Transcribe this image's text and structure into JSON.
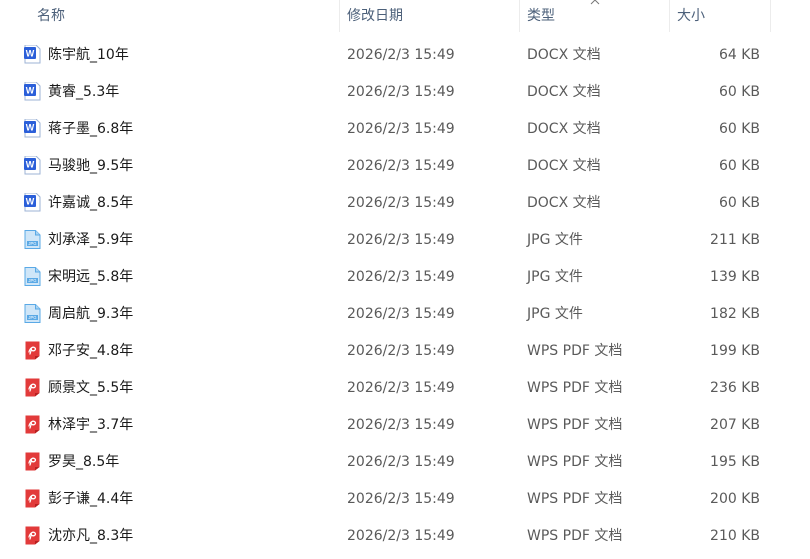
{
  "columns": {
    "name": "名称",
    "date": "修改日期",
    "type": "类型",
    "size": "大小"
  },
  "sort": {
    "column": "type",
    "direction": "ascending",
    "icon": "chevron-up-icon"
  },
  "colors": {
    "word": "#2b5fd9",
    "jpg": "#5aa9e6",
    "pdf": "#e23a3a"
  },
  "files": [
    {
      "icon": "word-doc-icon",
      "kind": "word",
      "name": "陈宇航_10年",
      "date": "2026/2/3 15:49",
      "type": "DOCX 文档",
      "size": "64 KB"
    },
    {
      "icon": "word-doc-icon",
      "kind": "word",
      "name": "黄睿_5.3年",
      "date": "2026/2/3 15:49",
      "type": "DOCX 文档",
      "size": "60 KB"
    },
    {
      "icon": "word-doc-icon",
      "kind": "word",
      "name": "蒋子墨_6.8年",
      "date": "2026/2/3 15:49",
      "type": "DOCX 文档",
      "size": "60 KB"
    },
    {
      "icon": "word-doc-icon",
      "kind": "word",
      "name": "马骏驰_9.5年",
      "date": "2026/2/3 15:49",
      "type": "DOCX 文档",
      "size": "60 KB"
    },
    {
      "icon": "word-doc-icon",
      "kind": "word",
      "name": "许嘉诚_8.5年",
      "date": "2026/2/3 15:49",
      "type": "DOCX 文档",
      "size": "60 KB"
    },
    {
      "icon": "jpg-image-icon",
      "kind": "jpg",
      "name": "刘承泽_5.9年",
      "date": "2026/2/3 15:49",
      "type": "JPG 文件",
      "size": "211 KB"
    },
    {
      "icon": "jpg-image-icon",
      "kind": "jpg",
      "name": "宋明远_5.8年",
      "date": "2026/2/3 15:49",
      "type": "JPG 文件",
      "size": "139 KB"
    },
    {
      "icon": "jpg-image-icon",
      "kind": "jpg",
      "name": "周启航_9.3年",
      "date": "2026/2/3 15:49",
      "type": "JPG 文件",
      "size": "182 KB"
    },
    {
      "icon": "wps-pdf-icon",
      "kind": "pdf",
      "name": "邓子安_4.8年",
      "date": "2026/2/3 15:49",
      "type": "WPS PDF 文档",
      "size": "199 KB"
    },
    {
      "icon": "wps-pdf-icon",
      "kind": "pdf",
      "name": "顾景文_5.5年",
      "date": "2026/2/3 15:49",
      "type": "WPS PDF 文档",
      "size": "236 KB"
    },
    {
      "icon": "wps-pdf-icon",
      "kind": "pdf",
      "name": "林泽宇_3.7年",
      "date": "2026/2/3 15:49",
      "type": "WPS PDF 文档",
      "size": "207 KB"
    },
    {
      "icon": "wps-pdf-icon",
      "kind": "pdf",
      "name": "罗昊_8.5年",
      "date": "2026/2/3 15:49",
      "type": "WPS PDF 文档",
      "size": "195 KB"
    },
    {
      "icon": "wps-pdf-icon",
      "kind": "pdf",
      "name": "彭子谦_4.4年",
      "date": "2026/2/3 15:49",
      "type": "WPS PDF 文档",
      "size": "200 KB"
    },
    {
      "icon": "wps-pdf-icon",
      "kind": "pdf",
      "name": "沈亦凡_8.3年",
      "date": "2026/2/3 15:49",
      "type": "WPS PDF 文档",
      "size": "210 KB"
    }
  ]
}
